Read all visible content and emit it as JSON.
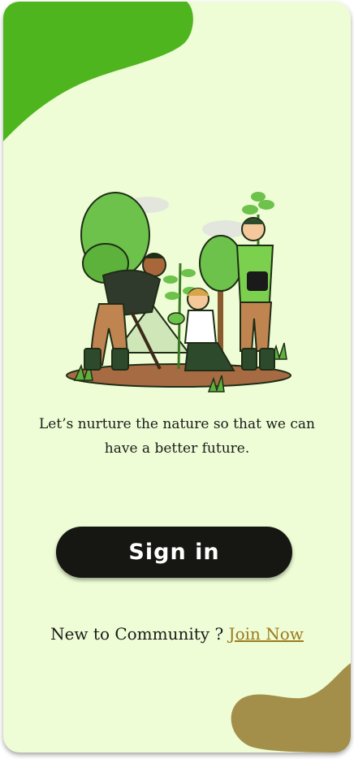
{
  "tagline": "Let’s nurture the nature so that we can have a better future.",
  "signin": {
    "label": "Sign in"
  },
  "footer": {
    "prompt": "New to Community ? ",
    "link_label": "Join Now"
  },
  "colors": {
    "background": "#eefdd5",
    "top_blob": "#4fb51f",
    "bottom_blob": "#a38f4a",
    "button": "#161712",
    "link": "#9b7a1e"
  }
}
